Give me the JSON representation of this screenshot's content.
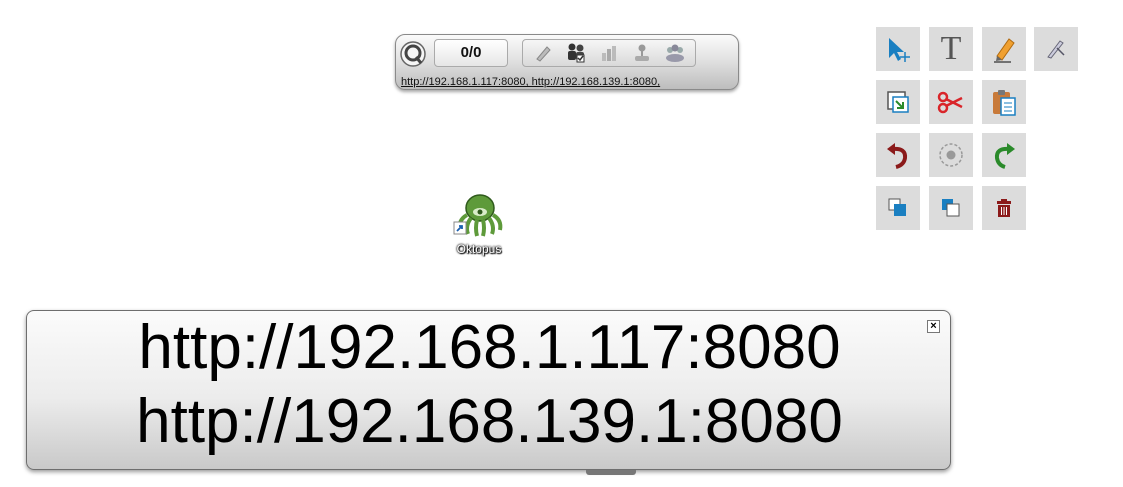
{
  "toolbar": {
    "counter": "0/0",
    "url_text": "http://192.168.1.117:8080, http://192.168.139.1:8080,",
    "buttons": [
      "pencil-icon",
      "users-check-icon",
      "chart-icon",
      "joystick-icon",
      "group-icon"
    ]
  },
  "palette": {
    "buttons": [
      "select-pointer-icon",
      "text-tool-icon",
      "pen-tool-icon",
      "highlighter-tool-icon",
      "capture-icon",
      "cut-icon",
      "paste-icon",
      "undo-icon",
      "record-icon",
      "redo-icon",
      "bring-front-icon",
      "send-back-icon",
      "delete-icon"
    ],
    "text_tool_glyph": "T"
  },
  "desktop_icon": {
    "label": "Oktopus"
  },
  "url_panel": {
    "lines": [
      "http://192.168.1.117:8080",
      "http://192.168.139.1:8080"
    ],
    "close_glyph": "×"
  },
  "colors": {
    "accent_blue": "#1a7fc1",
    "cut_red": "#d9252a",
    "undo_red": "#8b1a1a",
    "redo_green": "#2a8a2a"
  }
}
